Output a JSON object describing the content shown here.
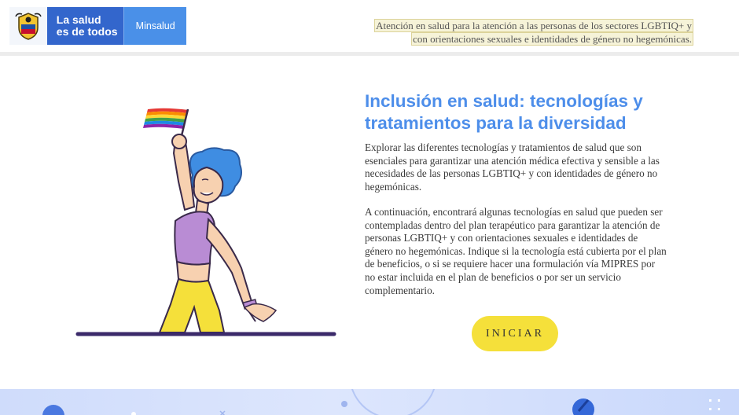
{
  "header": {
    "brand_line1": "La salud",
    "brand_line2": "es de todos",
    "ministry": "Minsalud",
    "tagline_line1": "Atención en salud para la atención a las personas de los sectores LGBTIQ+ y",
    "tagline_line2": "con orientaciones sexuales e identidades de género no hegemónicas."
  },
  "main": {
    "title": "Inclusión en salud: tecnologías y tratamientos para la diversidad",
    "paragraph1": "Explorar las diferentes tecnologías y tratamientos de salud que son esenciales para garantizar una atención médica efectiva y sensible a las necesidades de las personas LGBTIQ+ y con identidades de género no hegemónicas.",
    "paragraph2": "A continuación, encontrará algunas tecnologías en salud que pueden ser contempladas dentro del plan terapéutico para garantizar la atención de personas LGBTIQ+ y con orientaciones sexuales e identidades de género no hegemónicas. Indique si la tecnología está cubierta por el plan de beneficios, o si se requiere hacer una formulación vía MIPRES por no estar incluida en el plan de beneficios o por ser un servicio complementario.",
    "start_button": "INICIAR"
  },
  "icons": [
    "colombia-seal-icon",
    "fullscreen-icon"
  ],
  "colors": {
    "brand_blue": "#3366cc",
    "ministry_blue": "#4a90e8",
    "title_blue": "#4d8eea",
    "button_yellow": "#f5e03a",
    "footer_blue": "#cfdcfb"
  }
}
